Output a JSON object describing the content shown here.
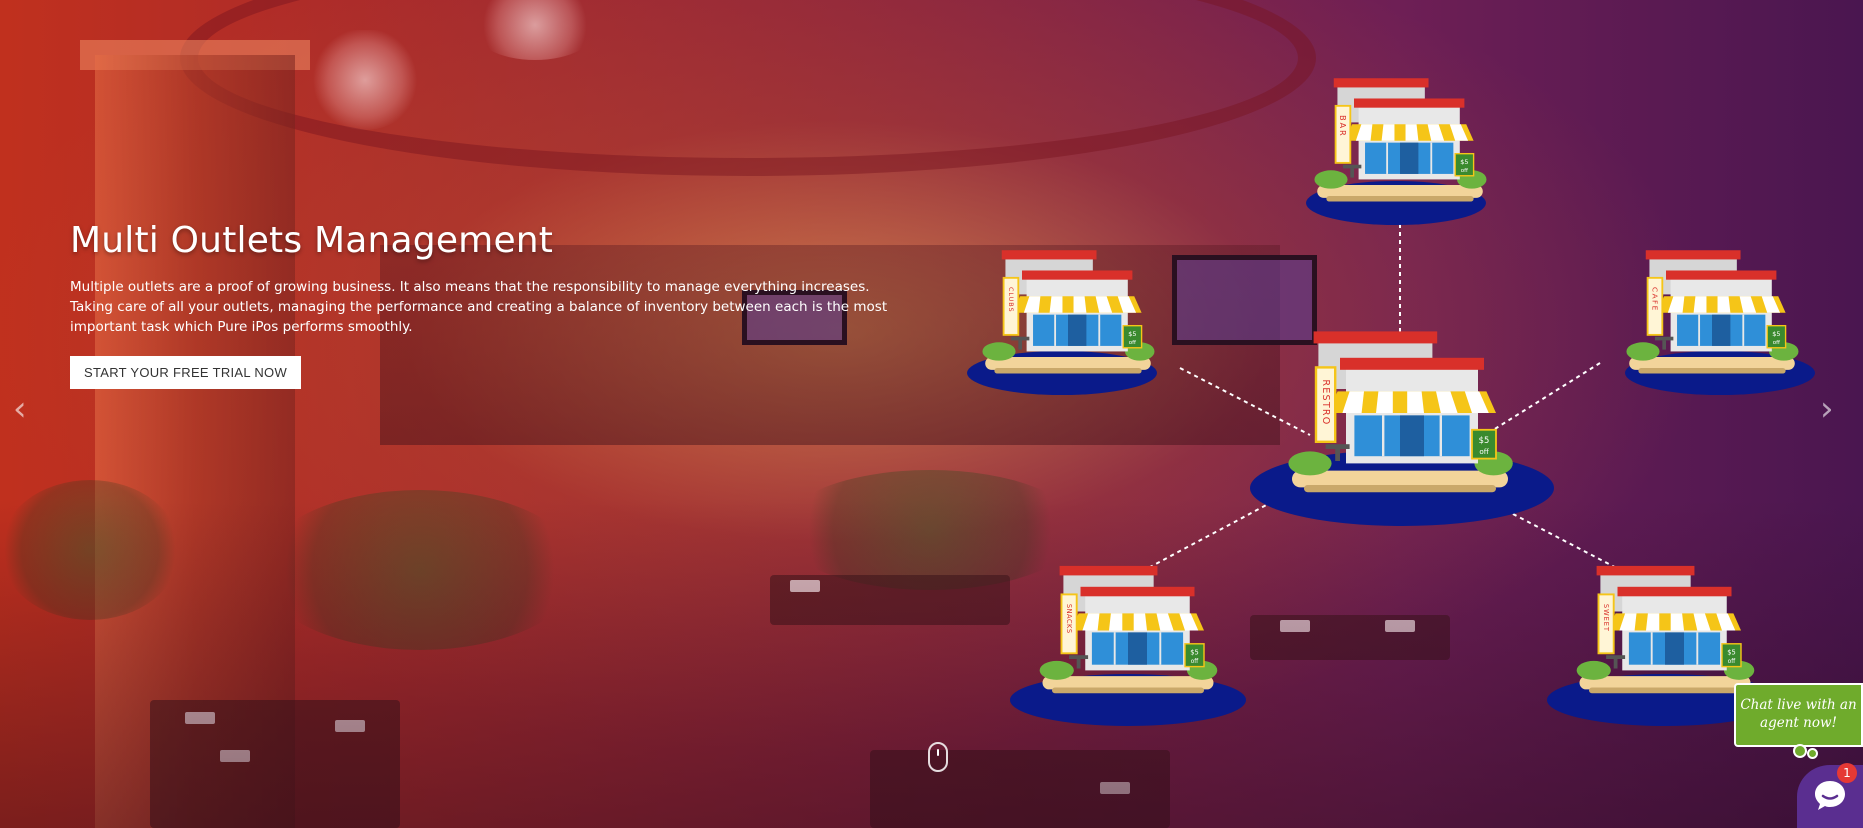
{
  "hero": {
    "title": "Multi Outlets Management",
    "description": "Multiple outlets are a proof of growing business. It also means that the responsibility to manage everything increases. Taking care of all your outlets, managing the performance and creating a balance of inventory between each is the most important task which Pure iPos performs smoothly.",
    "cta_label": "START YOUR FREE TRIAL NOW"
  },
  "carousel": {
    "prev_icon": "chevron-left-icon",
    "next_icon": "chevron-right-icon",
    "prev_glyph": "‹",
    "next_glyph": "›",
    "scroll_icon": "mouse-scroll-icon"
  },
  "outlets": {
    "center": {
      "sign": "RESTRO",
      "price": "$5",
      "price_note": "off"
    },
    "top": {
      "sign": "BAR",
      "price": "$5",
      "price_note": "off"
    },
    "left": {
      "sign": "CLUBS",
      "price": "$5",
      "price_note": "off"
    },
    "right": {
      "sign": "CAFE",
      "price": "$5",
      "price_note": "off"
    },
    "bottom_left": {
      "sign": "SNACKS",
      "price": "$5",
      "price_note": "off"
    },
    "bottom_right": {
      "sign": "SWEET",
      "price": "$5",
      "price_note": "off"
    }
  },
  "chat": {
    "bubble_text": "Chat live with an agent now!",
    "badge_count": "1"
  },
  "colors": {
    "overlay_left": "#c0301e",
    "overlay_right": "#4a1650",
    "platform": "#0a1a8a",
    "awning": "#f5c518",
    "roof": "#d9302a",
    "chat_green": "#6fab2c",
    "chat_launcher": "#5a2e90",
    "badge": "#e53935"
  }
}
